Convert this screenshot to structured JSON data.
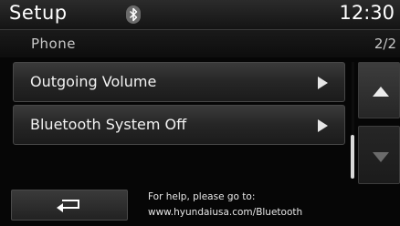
{
  "header": {
    "title": "Setup",
    "clock": "12:30",
    "bluetooth_icon": "bluetooth-icon"
  },
  "subheader": {
    "title": "Phone",
    "page": "2/2"
  },
  "menu": {
    "items": [
      {
        "label": "Outgoing Volume",
        "icon": "chevron-right-icon"
      },
      {
        "label": "Bluetooth System Off",
        "icon": "chevron-right-icon"
      }
    ]
  },
  "scroll": {
    "up_icon": "arrow-up-icon",
    "down_icon": "arrow-down-icon",
    "position": 1.0
  },
  "footer": {
    "back_icon": "back-return-icon",
    "help_line1": "For help, please go to:",
    "help_line2": "www.hyundaiusa.com/Bluetooth"
  },
  "colors": {
    "text": "#ffffff",
    "subtext": "#c8c8c8",
    "disabled_arrow": "#6b6b6b"
  }
}
